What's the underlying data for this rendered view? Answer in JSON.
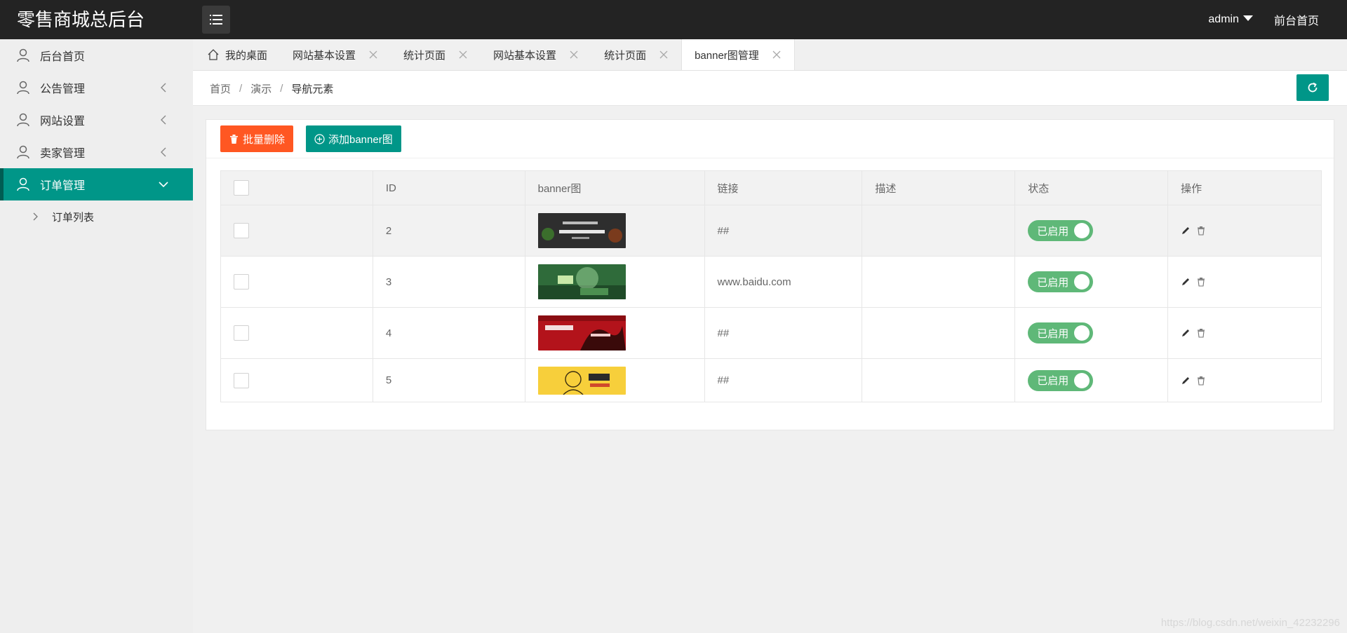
{
  "header": {
    "title": "零售商城总后台",
    "user": "admin",
    "front_link": "前台首页"
  },
  "sidebar": {
    "items": [
      {
        "label": "后台首页",
        "icon": "user-icon"
      },
      {
        "label": "公告管理",
        "icon": "user-icon"
      },
      {
        "label": "网站设置",
        "icon": "user-icon"
      },
      {
        "label": "卖家管理",
        "icon": "user-icon"
      },
      {
        "label": "订单管理",
        "icon": "user-icon"
      }
    ],
    "sub_items": [
      {
        "label": "订单列表"
      }
    ]
  },
  "tabs": [
    {
      "label": "我的桌面"
    },
    {
      "label": "网站基本设置"
    },
    {
      "label": "统计页面"
    },
    {
      "label": "网站基本设置"
    },
    {
      "label": "统计页面"
    },
    {
      "label": "banner图管理"
    }
  ],
  "breadcrumb": [
    "首页",
    "演示",
    "导航元素"
  ],
  "toolbar": {
    "batch_delete": "批量删除",
    "add_banner": "添加banner图"
  },
  "table": {
    "headers": [
      "ID",
      "banner图",
      "链接",
      "描述",
      "状态",
      "操作"
    ],
    "rows": [
      {
        "id": "2",
        "link": "##",
        "desc": "",
        "status": "已启用"
      },
      {
        "id": "3",
        "link": "www.baidu.com",
        "desc": "",
        "status": "已启用"
      },
      {
        "id": "4",
        "link": "##",
        "desc": "",
        "status": "已启用"
      },
      {
        "id": "5",
        "link": "##",
        "desc": "",
        "status": "已启用"
      }
    ]
  },
  "watermark": "https://blog.csdn.net/weixin_42232296",
  "colors": {
    "header_bg": "#232323",
    "primary": "#009688",
    "danger": "#ff5722",
    "switch_on": "#5fb878"
  }
}
